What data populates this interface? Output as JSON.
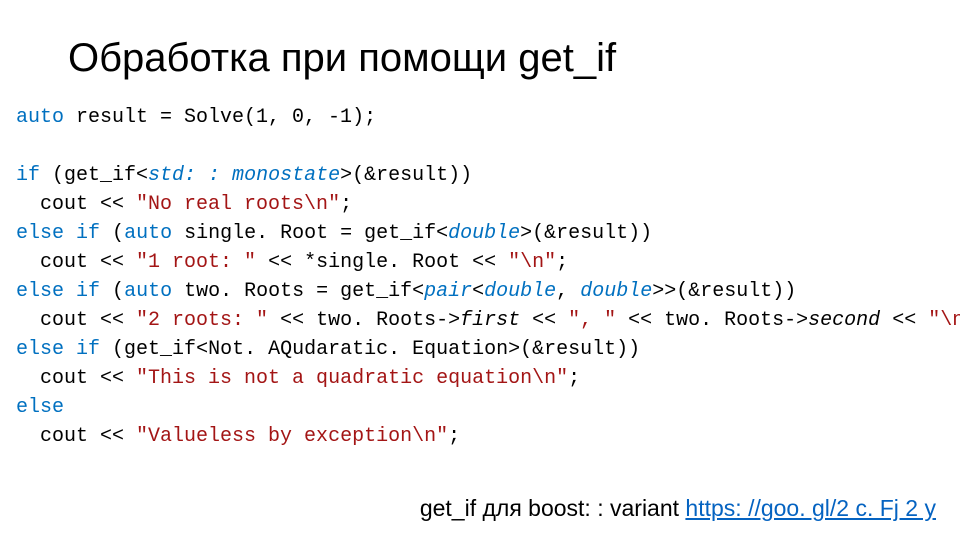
{
  "title": "Обработка при помощи get_if",
  "code": {
    "l1_auto": "auto",
    "l1_rest": " result = Solve(1, 0, -1);",
    "l3_if": "if",
    "l3_a": " (get_if<",
    "l3_t": "std: : monostate",
    "l3_b": ">(&result))",
    "l4_a": "  cout << ",
    "l4_s": "\"No real roots\\n\"",
    "l4_b": ";",
    "l5_else": "else",
    "l5_if": "if",
    "l5_a": " (",
    "l5_auto": "auto",
    "l5_b": " single. Root = get_if<",
    "l5_t": "double",
    "l5_c": ">(&result))",
    "l6_a": "  cout << ",
    "l6_s1": "\"1 root: \"",
    "l6_b": " << *single. Root << ",
    "l6_s2": "\"\\n\"",
    "l6_c": ";",
    "l7_else": "else",
    "l7_if": "if",
    "l7_a": " (",
    "l7_auto": "auto",
    "l7_b": " two. Roots = get_if<",
    "l7_t": "pair",
    "l7_c": "<",
    "l7_t2": "double",
    "l7_d": ", ",
    "l7_t3": "double",
    "l7_e": ">>(&result))",
    "l8_a": "  cout << ",
    "l8_s1": "\"2 roots: \"",
    "l8_b": " << two. Roots->",
    "l8_m1": "first",
    "l8_c": " << ",
    "l8_s2": "\", \"",
    "l8_d": " << two. Roots->",
    "l8_m2": "second",
    "l8_e": " << ",
    "l8_s3": "\"\\n\"",
    "l8_f": ";",
    "l9_else": "else",
    "l9_if": "if",
    "l9_a": " (get_if<Not. AQudaratic. Equation>(&result))",
    "l10_a": "  cout << ",
    "l10_s": "\"This is not a quadratic equation\\n\"",
    "l10_b": ";",
    "l11_else": "else",
    "l12_a": "  cout << ",
    "l12_s": "\"Valueless by exception\\n\"",
    "l12_b": ";"
  },
  "footer": {
    "text": "get_if для boost: : variant  ",
    "link_text": "https: //goo. gl/2 c. Fj 2 y",
    "link_href": "#"
  }
}
